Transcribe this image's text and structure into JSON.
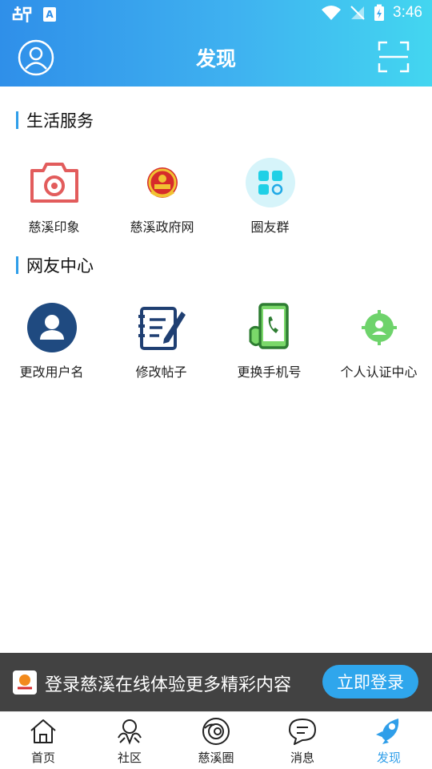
{
  "status_bar": {
    "time": "3:46",
    "app_badge": "A"
  },
  "header": {
    "title": "发现"
  },
  "sections": [
    {
      "title": "生活服务",
      "items": [
        {
          "label": "慈溪印象",
          "icon": "camera-icon"
        },
        {
          "label": "慈溪政府网",
          "icon": "national-emblem-icon"
        },
        {
          "label": "圈友群",
          "icon": "group-grid-icon"
        }
      ]
    },
    {
      "title": "网友中心",
      "items": [
        {
          "label": "更改用户名",
          "icon": "user-icon"
        },
        {
          "label": "修改帖子",
          "icon": "edit-post-icon"
        },
        {
          "label": "更换手机号",
          "icon": "phone-icon"
        },
        {
          "label": "个人认证中心",
          "icon": "verify-user-icon"
        }
      ]
    }
  ],
  "login_banner": {
    "text": "登录慈溪在线体验更多精彩内容",
    "button": "立即登录"
  },
  "tabs": [
    {
      "label": "首页",
      "icon": "home-icon"
    },
    {
      "label": "社区",
      "icon": "community-icon"
    },
    {
      "label": "慈溪圈",
      "icon": "circle-icon"
    },
    {
      "label": "消息",
      "icon": "message-icon"
    },
    {
      "label": "发现",
      "icon": "rocket-icon",
      "active": true
    }
  ],
  "colors": {
    "accent": "#2f9ee9",
    "header_start": "#2f8fe9",
    "header_end": "#43d6f0"
  }
}
